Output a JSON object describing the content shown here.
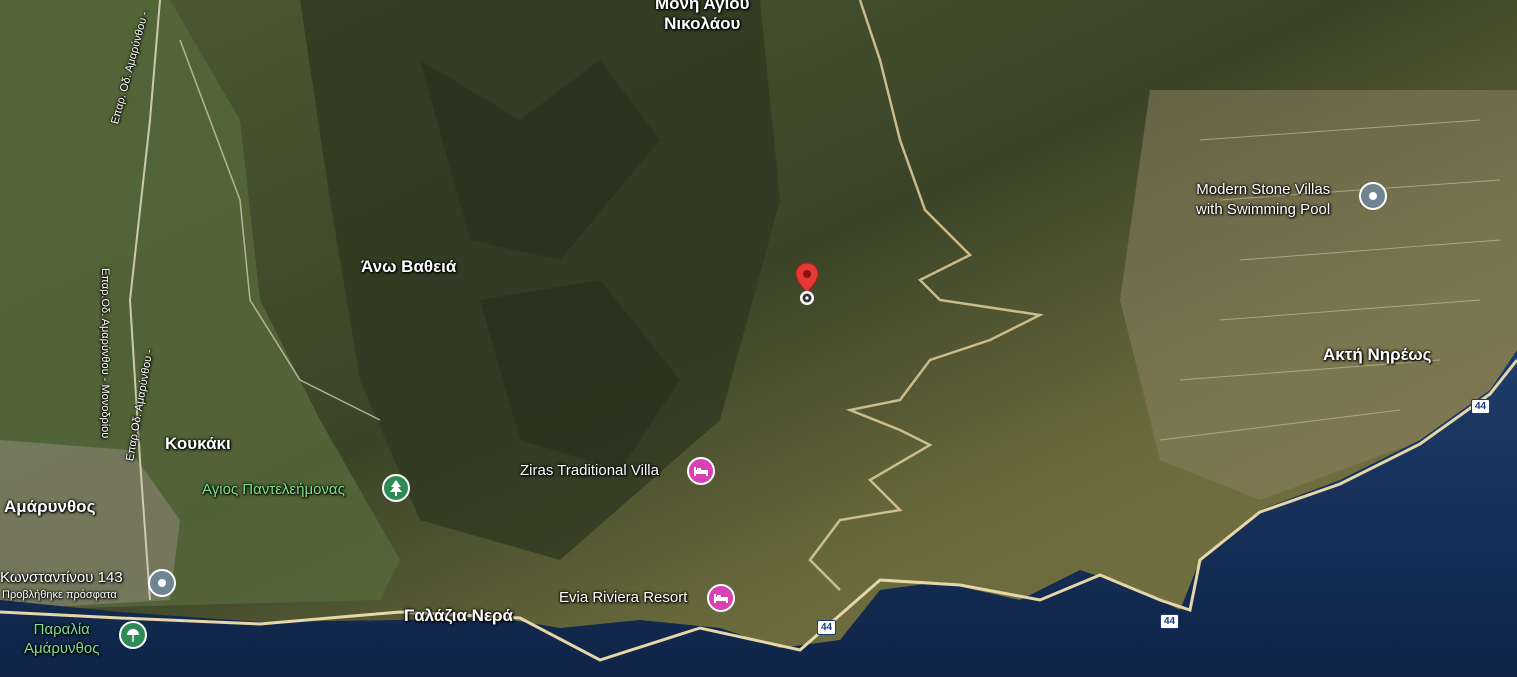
{
  "map": {
    "places": {
      "top_label": "Μονή Αγίου\nΝικολάου",
      "ano_vatheia": "Άνω Βαθειά",
      "koukaki": "Κουκάκι",
      "amarynthos": "Αμάρυνθος",
      "galazia_nera": "Γαλάζια Νερά",
      "akti_nireos": "Ακτή Νηρέως"
    },
    "roads": {
      "road_top": "Επαρ. Οδ. Αμαρύνθου -",
      "road_left": "Επαρ.Οδ. Αμαρύνθου - Μονοδρίου",
      "road_mid": "Επαρ.Οδ. Αμαρύνθου -",
      "route_badge_1": "44",
      "route_badge_2": "44",
      "route_badge_3": "44"
    },
    "pois": {
      "modern_stone_villas": "Modern Stone Villas\nwith Swimming Pool",
      "ziras_villa": "Ziras Traditional Villa",
      "evia_riviera": "Evia Riviera Resort",
      "agios_panteleimonas": "Αγιος Παντελεήμονας",
      "konstantinou": "Κωνσταντίνου 143",
      "konstantinou_sub": "Προβλήθηκε πρόσφατα",
      "paralia": "Παραλία\nΑμάρυνθος"
    },
    "icons": {
      "selected_pin": "red-location-pin-icon",
      "hotel": "bed-icon",
      "park": "tree-icon",
      "beach": "umbrella-icon",
      "place": "circle-pin-icon"
    },
    "colors": {
      "sea": "#16305a",
      "land": "#4b5734",
      "road": "#e6d6a8",
      "hotel_pin": "#d940b4",
      "park_label": "#7ee08a",
      "selected_pin": "#e53935"
    }
  }
}
